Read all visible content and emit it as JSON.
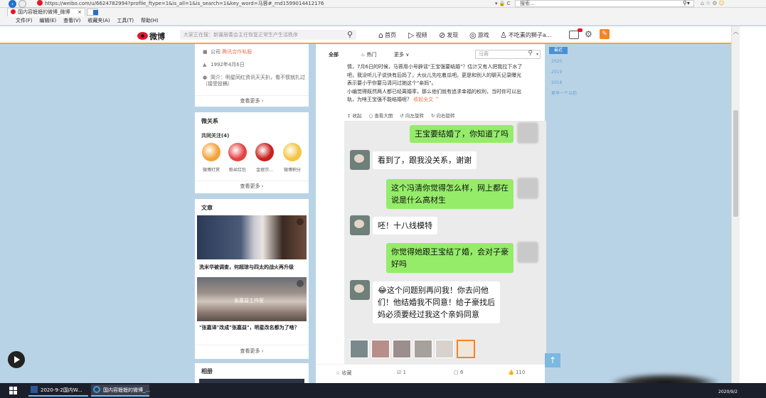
{
  "browser": {
    "url": "https://weibo.com/u/6624782994?profile_ftype=1&is_all=1&is_search=1&key_word=马蓉#_rnd1599014412176",
    "address_tools": "▾ 🔒 C",
    "search_placeholder": "搜索...",
    "tab_title": "国内容嬷嬷的微博_微博",
    "menu": [
      "文件(F)",
      "编辑(E)",
      "查看(V)",
      "收藏夹(A)",
      "工具(T)",
      "帮助(H)"
    ]
  },
  "weibo_nav": {
    "logo": "微博",
    "search_placeholder": "大家正在搜：新疆居委会主任恢复正常生产生活秩序",
    "links": [
      {
        "label": "首页",
        "icon": "⌂"
      },
      {
        "label": "视频",
        "icon": "▷"
      },
      {
        "label": "发现",
        "icon": "⊘"
      },
      {
        "label": "游戏",
        "icon": "◎"
      },
      {
        "label": "不吃素的狮子a...",
        "icon": "♙"
      }
    ]
  },
  "profile": {
    "company_prefix": "公司",
    "company": "腾讯合作私服",
    "birthday": "1992年4月6日",
    "bio_label": "简介：",
    "bio": "明星同红资讯天天扒，看不惯就扎过（接受投稿）",
    "see_more": "查看更多 ›"
  },
  "relations": {
    "title": "微关系",
    "common_follow": "共同关注(4)",
    "items": [
      {
        "name": "微博打赏",
        "color": "#f2a33a"
      },
      {
        "name": "粉丝红包",
        "color": "#e64242"
      },
      {
        "name": "金珉宗...",
        "color": "#c8201c"
      },
      {
        "name": "微博积分",
        "color": "#f4c542"
      }
    ],
    "see_more": "查看更多 ›"
  },
  "articles": {
    "title": "文章",
    "items": [
      {
        "title": "洗米华被调查，何超琼与四太的战火再升级"
      },
      {
        "title": "\"张嘉译\"改成\"张嘉益\"，明星改名都为了啥？",
        "overlay": "张嘉益工作室"
      }
    ],
    "see_more": "查看更多 ›"
  },
  "album_title": "相册",
  "feed": {
    "tabs": {
      "all": "全部",
      "hot": "热门",
      "more": "更多 ∨"
    },
    "search_value": "马蓉",
    "post_lines": [
      "情，7月6日的时候，马蓉用小号辟谣\"王宝强要结婚\"？估计又有人把我拉下水了",
      "吧，我没听儿子说快有后妈了，大伙儿先吃着瓜吧。更是和别人的聊天记录曝光",
      "表示要小乎你要马清问过她这个\"亲妈\"。",
      "小编觉得既然两人都已经离婚率，那么他们就有追求幸福的权利，当时你可以出",
      "轨，为啥王宝强不能结婚呢？"
    ],
    "post_collapse": "收起全文 ^",
    "post_actions": [
      "↥ 收起",
      "○ 查看大图",
      "↺ 向左旋转",
      "↻ 向右旋转"
    ],
    "chat": [
      {
        "side": "me",
        "text": [
          "王宝要结婚了，你知道了吗"
        ]
      },
      {
        "side": "other",
        "text": [
          "看到了，跟我没关系，谢谢"
        ]
      },
      {
        "side": "me",
        "text": [
          "这个冯清你觉得怎么样，网上都在",
          "说是什么高材生"
        ]
      },
      {
        "side": "other",
        "text": [
          "呸！十八线模特"
        ]
      },
      {
        "side": "me",
        "text": [
          "你觉得她跟王宝结了婚，会对子豪",
          "好吗"
        ]
      },
      {
        "side": "other",
        "text": [
          "😂这个问题别再问我！你去问他",
          "们！他结婚我不同意！给子豪找后",
          "妈必须要经过我这个亲妈同意"
        ]
      }
    ],
    "footer": [
      {
        "label": "☆ 收藏"
      },
      {
        "label": "☑ 1"
      },
      {
        "label": "▢ 6"
      },
      {
        "label": "👍 110"
      }
    ]
  },
  "timeline": {
    "current": "最近",
    "years": [
      "2020",
      "2019",
      "2018",
      "更早一个以前"
    ]
  },
  "taskbar": {
    "word_app": "2020-9-2国内W...",
    "ie_app": "国内容嬷嬷的微博_...",
    "date": "2020/9/2"
  },
  "colors": {
    "weibo_red": "#e6162d",
    "weibo_orange": "#f6a33c",
    "wechat_green": "#95ec69",
    "page_bg": "#b9d3e6"
  }
}
